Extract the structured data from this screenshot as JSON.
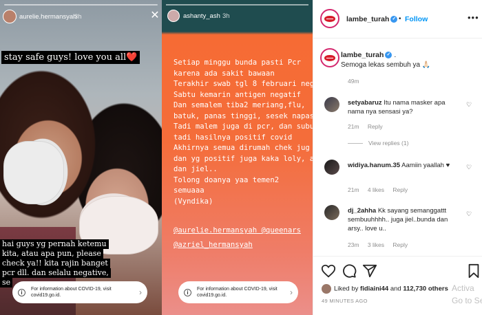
{
  "story_left": {
    "username": "aurelie.hermansyah",
    "time": "3h",
    "caption_top": "stay safe guys! love you all❤️",
    "caption_lines": [
      "hai guys yg pernah ketemu",
      "kita, atau apa pun, please",
      "check ya!! kita rajin banget",
      "pcr dll. dan selalu negative,",
      "se"
    ],
    "covid_notice": "For information about COVID-19, visit covid19.go.id."
  },
  "story_middle": {
    "username": "ashanty_ash",
    "time": "3h",
    "lines": [
      "Setiap minggu bunda pasti Pcr",
      "karena ada sakit bawaan",
      "Terakhir swab tgl 8 februari negat",
      "Sabtu kemarin antigen negatif",
      "Dan semalem tiba2 meriang,flu,",
      "batuk, panas tinggi, sesek napas",
      "Tadi malem juga di pcr, dan subuh",
      "tadi hasilnya positif covid",
      "Akhirnya semua dirumah chek jug",
      "dan yg positif juga kaka loly, arsy",
      "dan jiel..",
      "Tolong doanya yaa temen2",
      "semuaaa",
      "(Vyndika)"
    ],
    "links": [
      "@aurelie.hermansyah @queenars",
      "@azriel_hermansyah"
    ],
    "covid_notice": "For information about COVID-19, visit covid19.go.id."
  },
  "post": {
    "header_username": "lambe_turah",
    "follow_label": "Follow",
    "follow_separator": "•",
    "more_label": "•••",
    "caption_username": "lambe_turah",
    "caption_suffix": ".",
    "caption_text": "Semoga lekas sembuh ya 🙏🏻",
    "caption_time": "49m",
    "comments": [
      {
        "username": "setyabaruz",
        "text": "Itu nama masker apa nama nya sensasi ya?",
        "time": "21m",
        "likes": "",
        "reply_label": "Reply"
      },
      {
        "username": "widiya.hanum.35",
        "text": "Aamiin yaallah ♥",
        "time": "21m",
        "likes": "4 likes",
        "reply_label": "Reply"
      },
      {
        "username": "dj_2ahha",
        "text": "Kk sayang semanggattt sembuuhhhh.. juga jiel..bunda dan arsy.. love u..",
        "time": "23m",
        "likes": "3 likes",
        "reply_label": "Reply"
      }
    ],
    "view_replies": "View replies (1)",
    "liked_by_prefix": "Liked by",
    "liked_by_user": "fidiaini44",
    "liked_by_and": "and",
    "liked_by_others": "112,730 others",
    "posted_ago": "49 MINUTES AGO",
    "watermark_line1": "Activa",
    "watermark_line2": "Go to Se"
  },
  "colors": {
    "brand_blue": "#0095f6",
    "verified": "#3897f0",
    "ring": "#d4286e",
    "story_orange": "#f46d3a"
  }
}
